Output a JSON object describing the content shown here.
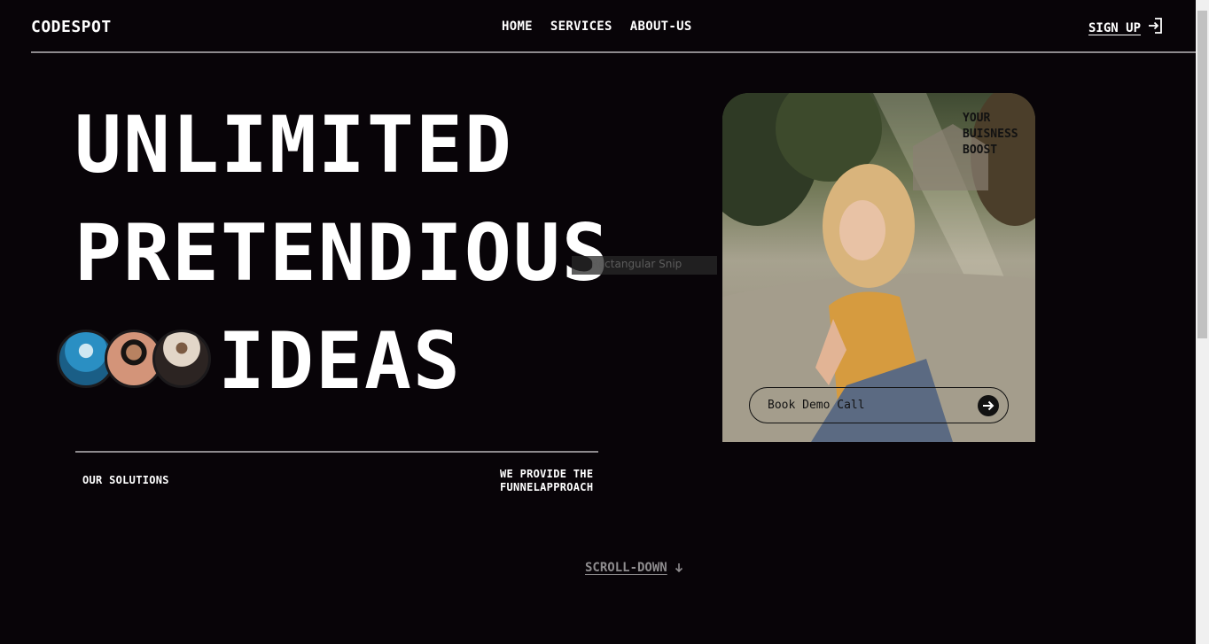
{
  "header": {
    "logo": "CODESPOT",
    "nav": [
      {
        "label": "HOME"
      },
      {
        "label": "SERVICES"
      },
      {
        "label": "ABOUT-US"
      }
    ],
    "signup_label": "SIGN UP",
    "signup_icon": "sign-in-icon"
  },
  "hero": {
    "line1": "UNLIMITED",
    "line2": "PRETENDIOUS",
    "line3": "IDEAS",
    "avatars": [
      "avatar-blue-hoodie",
      "avatar-sunglasses-man",
      "avatar-hat-woman"
    ],
    "snip_overlay": "Rectangular Snip"
  },
  "solutions": {
    "label": "OUR SOLUTIONS",
    "provide": "WE PROVIDE THE FUNNELAPPROACH"
  },
  "card": {
    "tagline": "YOUR\nBUISNESS\nBOOST",
    "button_label": "Book Demo Call",
    "button_icon": "arrow-right-icon"
  },
  "scroll": {
    "label": "SCROLL-DOWN",
    "icon": "arrow-down-icon"
  },
  "colors": {
    "background": "#080408",
    "text": "#ffffff",
    "muted": "#8e8c8e",
    "divider": "#8d8a8d"
  }
}
